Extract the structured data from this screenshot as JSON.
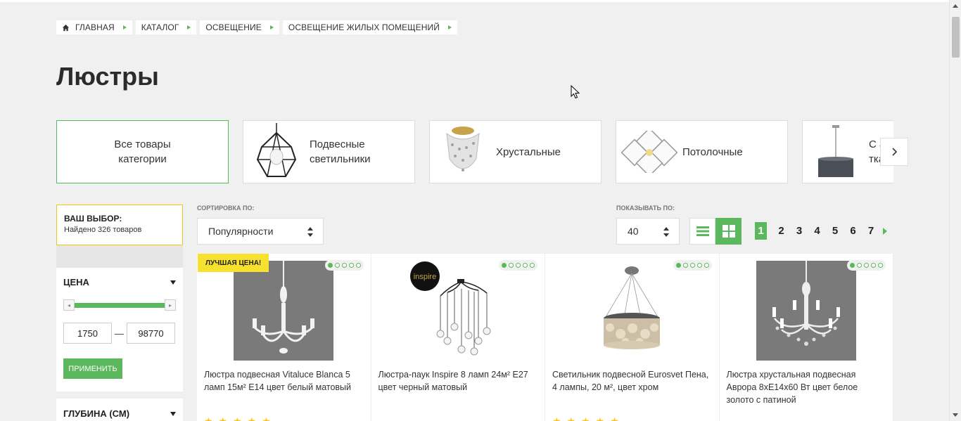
{
  "breadcrumbs": [
    {
      "label": "ГЛАВНАЯ"
    },
    {
      "label": "КАТАЛОГ"
    },
    {
      "label": "ОСВЕЩЕНИЕ"
    },
    {
      "label": "ОСВЕЩЕНИЕ ЖИЛЫХ ПОМЕЩЕНИЙ"
    }
  ],
  "page_title": "Люстры",
  "categories": [
    {
      "label_line1": "Все товары",
      "label_line2": "категории",
      "icon": "none",
      "active": true
    },
    {
      "label_line1": "Подвесные",
      "label_line2": "светильники",
      "icon": "pendant-cage-lamp-icon"
    },
    {
      "label_line1": "Хрустальные",
      "label_line2": "",
      "icon": "crystal-chandelier-icon"
    },
    {
      "label_line1": "Потолочные",
      "label_line2": "",
      "icon": "ceiling-led-lamp-icon"
    },
    {
      "label_line1": "С а",
      "label_line2": "тка",
      "icon": "fabric-shade-lamp-icon"
    }
  ],
  "sidebar": {
    "choice_title": "ВАШ ВЫБОР:",
    "choice_found": "Найдено 326 товаров",
    "price_filter": {
      "title": "ЦЕНА",
      "min": "1750",
      "max": "98770",
      "dash": "—",
      "apply_label": "ПРИМЕНИТЬ",
      "range_fraction": [
        0.0,
        1.0
      ]
    },
    "depth_filter": {
      "title": "ГЛУБИНА (СМ)"
    }
  },
  "toolbar": {
    "sort_label": "СОРТИРОВКА ПО:",
    "sort_value": "Популярности",
    "perpage_label": "ПОКАЗЫВАТЬ ПО:",
    "perpage_value": "40",
    "view_mode": "grid",
    "pages": [
      "1",
      "2",
      "3",
      "4",
      "5",
      "6",
      "7"
    ],
    "current_page": "1"
  },
  "products": [
    {
      "name": "Люстра подвесная Vitaluce Blanca 5 ламп 15м² E14 цвет белый матовый",
      "badge": "ЛУЧШАЯ ЦЕНА!",
      "rating_dots": 1,
      "stars": "★★★★★",
      "image": "white-chandelier-photo"
    },
    {
      "name": "Люстра-паук Inspire 8 ламп 24м² E27 цвет черный матовый",
      "badge": "",
      "rating_dots": 1,
      "stars": "",
      "image": "spider-pendant-photo"
    },
    {
      "name": "Светильник подвесной Eurosvet Пена, 4 лампы, 20 м², цвет хром",
      "badge": "",
      "rating_dots": 1,
      "stars": "★★★★★",
      "image": "shell-pendant-photo"
    },
    {
      "name": "Люстра хрустальная подвесная Аврора 8хЕ14х60 Вт цвет белое золото с патиной",
      "badge": "",
      "rating_dots": 1,
      "stars": "",
      "image": "crystal-chandelier-photo"
    }
  ],
  "colors": {
    "accent": "#5cb85c",
    "badge": "#f5e12e",
    "choice_border": "#f0c419"
  }
}
